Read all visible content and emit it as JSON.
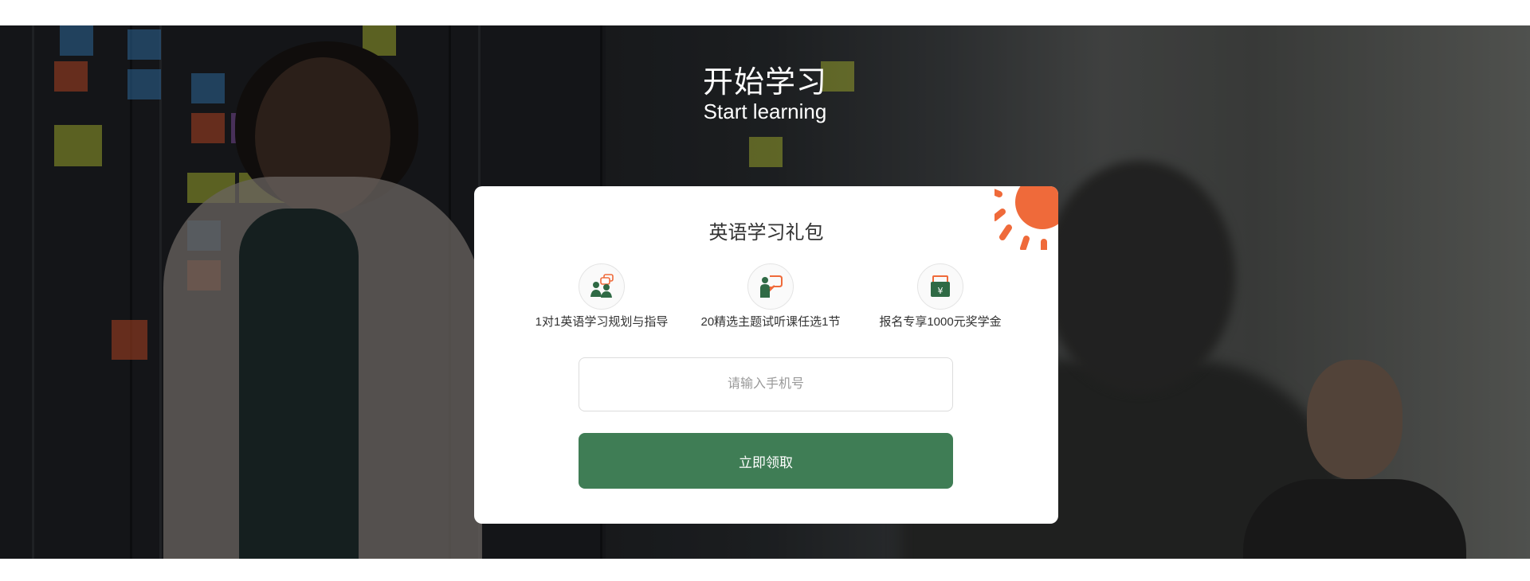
{
  "hero": {
    "title": "开始学习",
    "subtitle": "Start learning"
  },
  "card": {
    "title": "英语学习礼包",
    "features": [
      {
        "icon": "people-chat-icon",
        "label": "1对1英语学习规划与指导"
      },
      {
        "icon": "teacher-board-icon",
        "label": "20精选主题试听课任选1节"
      },
      {
        "icon": "gift-scholarship-icon",
        "label": "报名专享1000元奖学金"
      }
    ],
    "phone_placeholder": "请输入手机号",
    "phone_value": "",
    "submit_label": "立即领取"
  },
  "colors": {
    "accent_green": "#3f7d55",
    "accent_orange": "#ef6a3a",
    "icon_green": "#2f6a45",
    "text_dark": "#333333"
  }
}
